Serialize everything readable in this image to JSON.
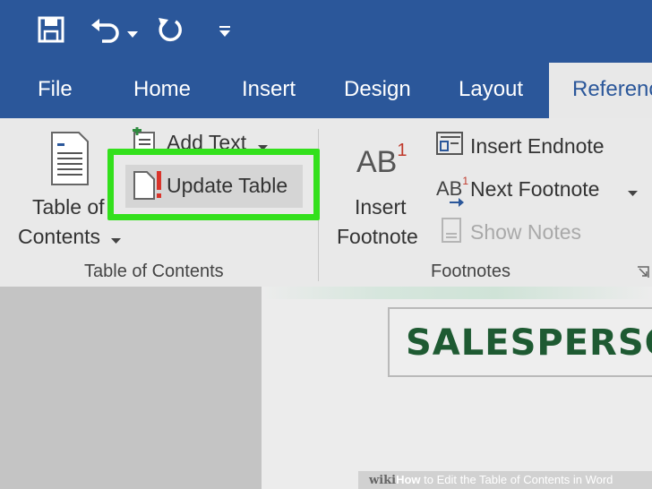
{
  "quick_access": {
    "save_icon": "save-icon",
    "undo_icon": "undo-icon",
    "undo_dropdown_icon": "chevron-down-icon",
    "redo_icon": "redo-icon",
    "customize_icon": "customize-qat-icon"
  },
  "tabs": [
    {
      "label": "File"
    },
    {
      "label": "Home"
    },
    {
      "label": "Insert"
    },
    {
      "label": "Design"
    },
    {
      "label": "Layout"
    },
    {
      "label": "Referenc"
    }
  ],
  "ribbon": {
    "toc_group": {
      "toc_button_line1": "Table of",
      "toc_button_line2": "Contents",
      "add_text_label": "Add Text",
      "update_table_label": "Update Table",
      "group_label": "Table of Contents"
    },
    "footnotes_group": {
      "insert_footnote_icon_text": "AB",
      "insert_footnote_icon_sup": "1",
      "insert_footnote_line1": "Insert",
      "insert_footnote_line2": "Footnote",
      "insert_endnote_label": "Insert Endnote",
      "next_footnote_icon_text": "AB",
      "next_footnote_icon_sup": "1",
      "next_footnote_label": "Next Footnote",
      "show_notes_label": "Show Notes",
      "group_label": "Footnotes"
    }
  },
  "document": {
    "title_text": "SALESPERSO"
  },
  "watermark": {
    "wiki": "wiki",
    "how": "How",
    "rest": " to Edit the Table of Contents in Word"
  },
  "colors": {
    "ribbon_blue": "#2b579a",
    "highlight_green": "#33e01c",
    "doc_title_green": "#1e5a32"
  }
}
